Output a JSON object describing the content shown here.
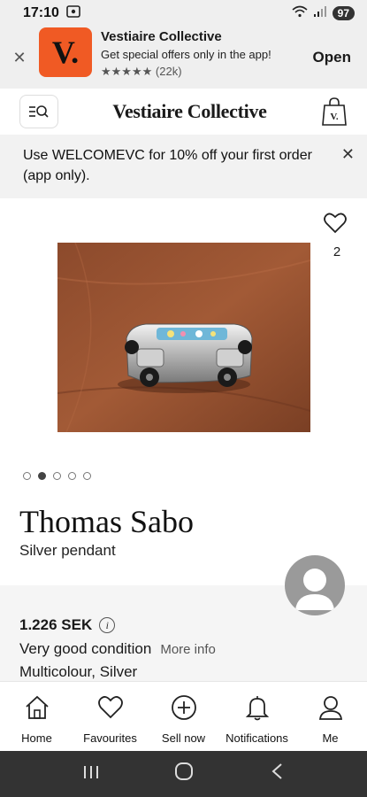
{
  "status": {
    "time": "17:10",
    "battery": "97"
  },
  "app_banner": {
    "logo_text": "V.",
    "title": "Vestiaire Collective",
    "subtitle": "Get special offers only in the app!",
    "stars": "★★★★★",
    "reviews": "(22k)",
    "open_label": "Open"
  },
  "header": {
    "brand": "Vestiaire Collective",
    "bag_letter": "V."
  },
  "promo": {
    "text": "Use WELCOMEVC for 10% off your first order (app only)."
  },
  "product": {
    "favourite_count": "2",
    "brand": "Thomas Sabo",
    "name": "Silver pendant",
    "image_count": 5,
    "active_image": 2
  },
  "details": {
    "price": "1.226 SEK",
    "info_icon": "i",
    "condition": "Very good condition",
    "more_info": "More info",
    "colors": "Multicolour, Silver"
  },
  "nav": {
    "items": [
      {
        "label": "Home",
        "icon": "home-icon"
      },
      {
        "label": "Favourites",
        "icon": "heart-icon"
      },
      {
        "label": "Sell now",
        "icon": "plus-circle-icon"
      },
      {
        "label": "Notifications",
        "icon": "bell-icon"
      },
      {
        "label": "Me",
        "icon": "user-icon"
      }
    ]
  },
  "colors": {
    "accent": "#f05a24",
    "status_bg": "#efefef",
    "system_nav": "#333333"
  }
}
